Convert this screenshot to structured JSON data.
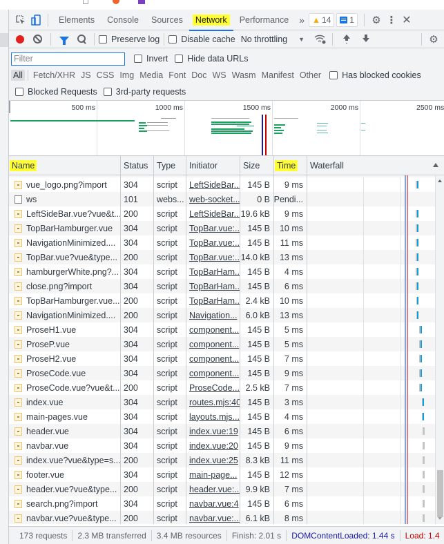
{
  "tabs": {
    "items": [
      {
        "label": "Elements",
        "active": false
      },
      {
        "label": "Console",
        "active": false
      },
      {
        "label": "Sources",
        "active": false
      },
      {
        "label": "Network",
        "active": true
      },
      {
        "label": "Performance",
        "active": false
      }
    ],
    "more": "»",
    "warnings_count": "14",
    "messages_count": "1"
  },
  "toolbar": {
    "preserve_log": "Preserve log",
    "disable_cache": "Disable cache",
    "throttling": "No throttling"
  },
  "filter": {
    "placeholder": "Filter",
    "value": "",
    "invert": "Invert",
    "hide_data_urls": "Hide data URLs",
    "types": [
      "All",
      "Fetch/XHR",
      "JS",
      "CSS",
      "Img",
      "Media",
      "Font",
      "Doc",
      "WS",
      "Wasm",
      "Manifest",
      "Other"
    ],
    "active_type": "All",
    "has_blocked_cookies": "Has blocked cookies",
    "blocked_requests": "Blocked Requests",
    "third_party": "3rd-party requests"
  },
  "overview": {
    "ticks": [
      "500 ms",
      "1000 ms",
      "1500 ms",
      "2000 ms",
      "2500 ms"
    ],
    "dom_content_loaded_ms": 1440,
    "load_ms": 1460,
    "colors": {
      "dcl": "#1a1aa6",
      "load": "#c80000",
      "bars": "#1aa260"
    }
  },
  "columns": [
    "Name",
    "Status",
    "Type",
    "Initiator",
    "Size",
    "Time",
    "Waterfall"
  ],
  "highlighted_columns": [
    "Name",
    "Time"
  ],
  "rows": [
    {
      "name": "vue_logo.png?import",
      "status": "304",
      "type": "script",
      "initiator": "LeftSideBar...",
      "size": "145 B",
      "time": "9 ms",
      "icon": "file",
      "wf_start": 0.848,
      "wf_dl": 0.86
    },
    {
      "name": "ws",
      "status": "101",
      "type": "webs...",
      "initiator": "web-socket...",
      "size": "0 B",
      "time": "Pendi...",
      "icon": "ws",
      "wf_start": null,
      "wf_dl": null
    },
    {
      "name": "LeftSideBar.vue?vue&t...",
      "status": "200",
      "type": "script",
      "initiator": "LeftSideBar...",
      "size": "19.6 kB",
      "time": "9 ms",
      "icon": "file",
      "wf_start": 0.848,
      "wf_dl": 0.858
    },
    {
      "name": "TopBarHamburger.vue",
      "status": "304",
      "type": "script",
      "initiator": "TopBar.vue:...",
      "size": "145 B",
      "time": "10 ms",
      "icon": "file",
      "wf_start": 0.85,
      "wf_dl": 0.858
    },
    {
      "name": "NavigationMinimized....",
      "status": "304",
      "type": "script",
      "initiator": "TopBar.vue:...",
      "size": "145 B",
      "time": "11 ms",
      "icon": "file",
      "wf_start": 0.85,
      "wf_dl": 0.858
    },
    {
      "name": "TopBar.vue?vue&type...",
      "status": "200",
      "type": "script",
      "initiator": "TopBar.vue:...",
      "size": "14.0 kB",
      "time": "13 ms",
      "icon": "file",
      "wf_start": 0.848,
      "wf_dl": 0.86
    },
    {
      "name": "hamburgerWhite.png?...",
      "status": "304",
      "type": "script",
      "initiator": "TopBarHam...",
      "size": "145 B",
      "time": "4 ms",
      "icon": "file",
      "wf_start": 0.85,
      "wf_dl": 0.86
    },
    {
      "name": "close.png?import",
      "status": "304",
      "type": "script",
      "initiator": "TopBarHam...",
      "size": "145 B",
      "time": "6 ms",
      "icon": "file",
      "wf_start": 0.85,
      "wf_dl": 0.86
    },
    {
      "name": "TopBarHamburger.vue...",
      "status": "200",
      "type": "script",
      "initiator": "TopBarHam...",
      "size": "2.4 kB",
      "time": "10 ms",
      "icon": "file",
      "wf_start": 0.852,
      "wf_dl": 0.862
    },
    {
      "name": "NavigationMinimized....",
      "status": "200",
      "type": "script",
      "initiator": "Navigation...",
      "size": "6.0 kB",
      "time": "13 ms",
      "icon": "file",
      "wf_start": 0.852,
      "wf_dl": 0.862
    },
    {
      "name": "ProseH1.vue",
      "status": "304",
      "type": "script",
      "initiator": "component...",
      "size": "145 B",
      "time": "5 ms",
      "icon": "file",
      "wf_start": 0.875,
      "wf_dl": 0.885
    },
    {
      "name": "ProseP.vue",
      "status": "304",
      "type": "script",
      "initiator": "component...",
      "size": "145 B",
      "time": "5 ms",
      "icon": "file",
      "wf_start": 0.875,
      "wf_dl": 0.885
    },
    {
      "name": "ProseH2.vue",
      "status": "304",
      "type": "script",
      "initiator": "component...",
      "size": "145 B",
      "time": "7 ms",
      "icon": "file",
      "wf_start": 0.875,
      "wf_dl": 0.885
    },
    {
      "name": "ProseCode.vue",
      "status": "304",
      "type": "script",
      "initiator": "component...",
      "size": "145 B",
      "time": "9 ms",
      "icon": "file",
      "wf_start": 0.875,
      "wf_dl": 0.885
    },
    {
      "name": "ProseCode.vue?vue&t...",
      "status": "200",
      "type": "script",
      "initiator": "ProseCode....",
      "size": "2.5 kB",
      "time": "7 ms",
      "icon": "file",
      "wf_start": 0.877,
      "wf_dl": 0.887
    },
    {
      "name": "index.vue",
      "status": "304",
      "type": "script",
      "initiator": "routes.mjs:40",
      "size": "145 B",
      "time": "3 ms",
      "icon": "file",
      "wf_start": 0.895,
      "wf_dl": 0.9
    },
    {
      "name": "main-pages.vue",
      "status": "304",
      "type": "script",
      "initiator": "layouts.mjs...",
      "size": "145 B",
      "time": "4 ms",
      "icon": "file",
      "wf_start": 0.895,
      "wf_dl": 0.9
    },
    {
      "name": "header.vue",
      "status": "304",
      "type": "script",
      "initiator": "index.vue:19",
      "size": "145 B",
      "time": "6 ms",
      "icon": "file",
      "wf_start": 0.9,
      "wf_dl": null
    },
    {
      "name": "navbar.vue",
      "status": "304",
      "type": "script",
      "initiator": "index.vue:20",
      "size": "145 B",
      "time": "9 ms",
      "icon": "file",
      "wf_start": 0.9,
      "wf_dl": null
    },
    {
      "name": "index.vue?vue&type=s...",
      "status": "200",
      "type": "script",
      "initiator": "index.vue:25",
      "size": "8.3 kB",
      "time": "11 ms",
      "icon": "file",
      "wf_start": 0.9,
      "wf_dl": null
    },
    {
      "name": "footer.vue",
      "status": "304",
      "type": "script",
      "initiator": "main-page...",
      "size": "145 B",
      "time": "12 ms",
      "icon": "file",
      "wf_start": 0.9,
      "wf_dl": null
    },
    {
      "name": "header.vue?vue&type...",
      "status": "200",
      "type": "script",
      "initiator": "header.vue:...",
      "size": "9.9 kB",
      "time": "7 ms",
      "icon": "file",
      "wf_start": 0.9,
      "wf_dl": null
    },
    {
      "name": "search.png?import",
      "status": "304",
      "type": "script",
      "initiator": "navbar.vue:4",
      "size": "145 B",
      "time": "6 ms",
      "icon": "file",
      "wf_start": 0.9,
      "wf_dl": null
    },
    {
      "name": "navbar.vue?vue&type...",
      "status": "200",
      "type": "script",
      "initiator": "navbar.vue:...",
      "size": "6.1 kB",
      "time": "8 ms",
      "icon": "file",
      "wf_start": 0.9,
      "wf_dl": null
    }
  ],
  "statusbar": {
    "requests": "173 requests",
    "transferred": "2.3 MB transferred",
    "resources": "3.4 MB resources",
    "finish": "Finish: 2.01 s",
    "dom_content_loaded": "DOMContentLoaded: 1.44 s",
    "load": "Load: 1.4"
  }
}
